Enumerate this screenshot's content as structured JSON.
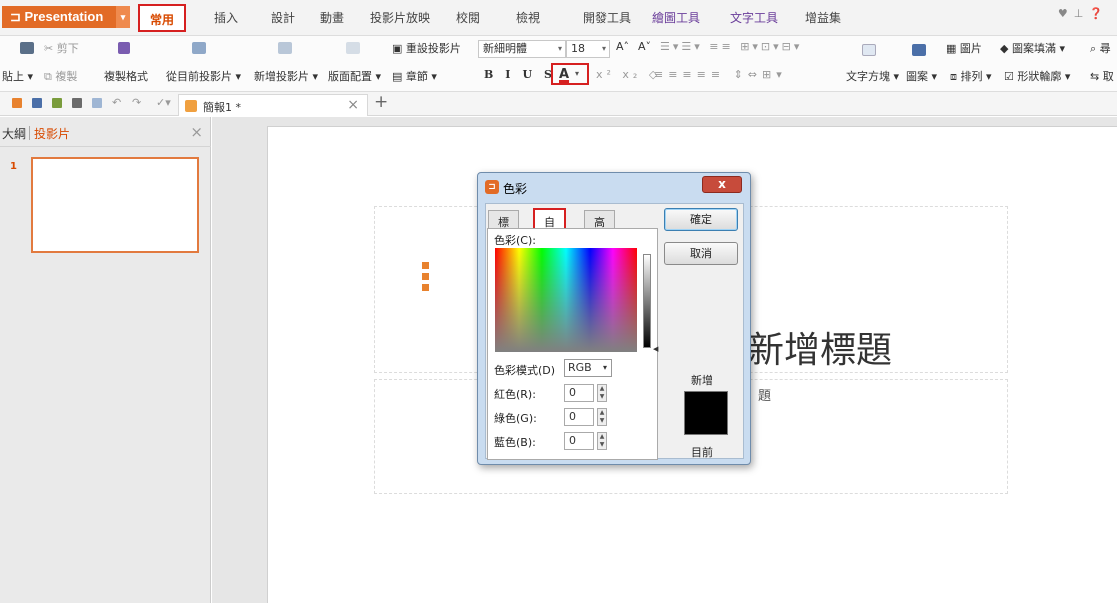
{
  "app": {
    "name": "Presentation"
  },
  "menu": {
    "tabs": [
      "常用",
      "插入",
      "設計",
      "動畫",
      "投影片放映",
      "校閱",
      "檢視",
      "開發工具",
      "繪圖工具",
      "文字工具",
      "增益集"
    ]
  },
  "ribbon": {
    "cut": "剪下",
    "paste": "貼上",
    "copy": "複製",
    "format_painter": "複製格式",
    "from_current_slide": "從目前投影片",
    "new_slide": "新增投影片",
    "layout": "版面配置",
    "reset_slide": "重設投影片",
    "section": "章節",
    "font_name": "新細明體",
    "font_size": "18",
    "text_box": "文字方塊",
    "shape": "圖案",
    "arrange": "排列",
    "picture": "圖片",
    "shape_fill": "圖案填滿",
    "shape_outline": "形狀輪廓",
    "find": "尋",
    "replace": "取"
  },
  "document": {
    "tab_title": "簡報1 *"
  },
  "left_pane": {
    "tabs": [
      "大綱",
      "投影片"
    ],
    "slide_number": "1"
  },
  "slide": {
    "title_text": "新增標題",
    "subtitle_text": "題"
  },
  "dialog": {
    "title": "色彩",
    "close_glyph": "x",
    "tabs": [
      "標準",
      "自訂",
      "高級"
    ],
    "color_label": "色彩(C):",
    "mode_label": "色彩模式(D)",
    "mode_value": "RGB",
    "red_label": "紅色(R):",
    "green_label": "綠色(G):",
    "blue_label": "藍色(B):",
    "red_value": "0",
    "green_value": "0",
    "blue_value": "0",
    "ok": "確定",
    "cancel": "取消",
    "new_label": "新增",
    "current_label": "目前",
    "preview_color": "#000000"
  },
  "colors": {
    "accent": "#e26b26",
    "highlight": "#d62020"
  }
}
